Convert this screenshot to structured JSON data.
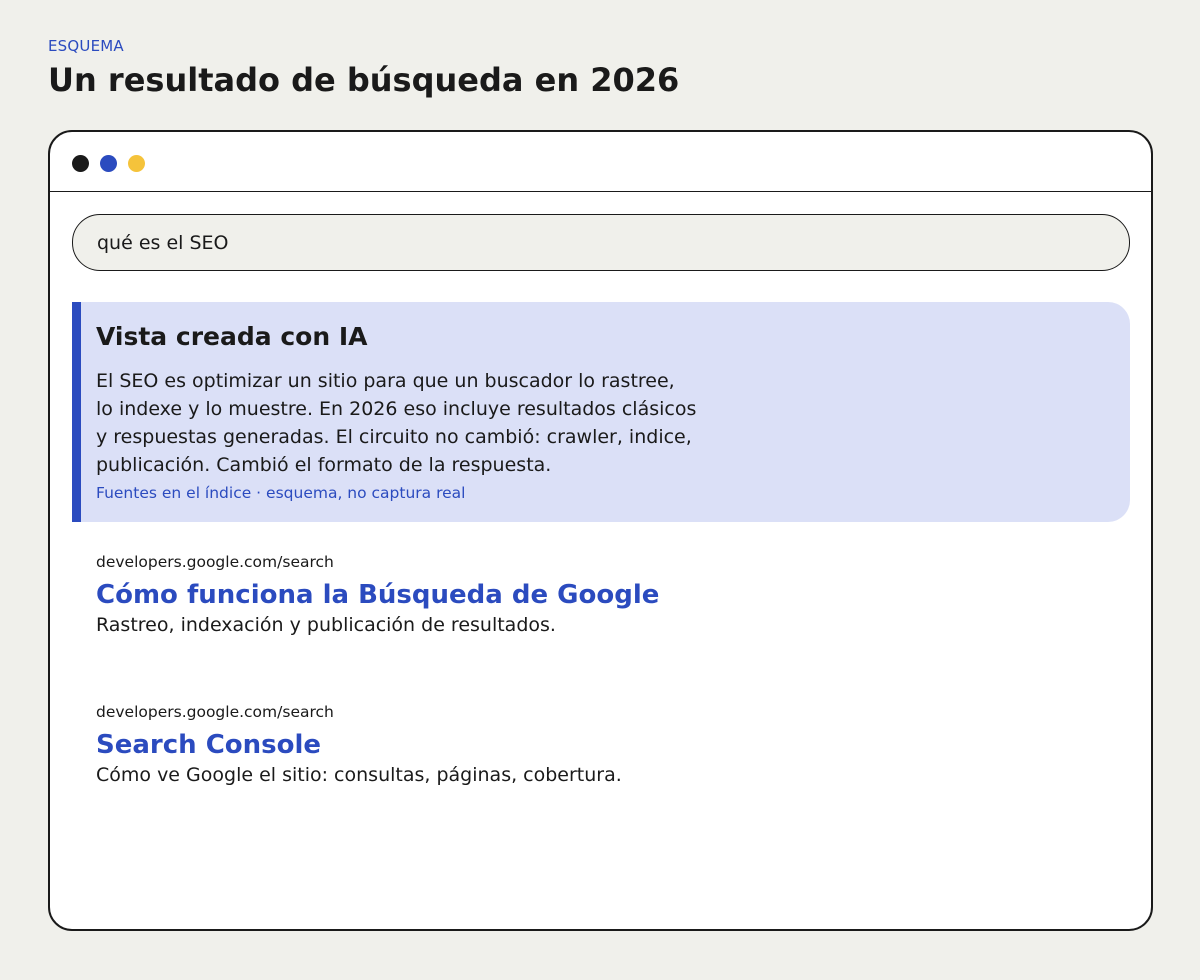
{
  "header": {
    "eyebrow": "ESQUEMA",
    "title": "Un resultado de búsqueda en 2026"
  },
  "window": {
    "dots": [
      "#1a1a1a",
      "#2b4bbf",
      "#f5c33b"
    ]
  },
  "search": {
    "query": "qué es el SEO"
  },
  "ai_overview": {
    "title": "Vista creada con IA",
    "lines": [
      "El SEO es optimizar un sitio para que un buscador lo rastree,",
      "lo indexe y lo muestre. En 2026 eso incluye resultados clásicos",
      "y respuestas generadas. El circuito no cambió: crawler, indice,",
      "publicación. Cambió el formato de la respuesta."
    ],
    "sources": "Fuentes en el índice · esquema, no captura real"
  },
  "results": [
    {
      "url": "developers.google.com/search",
      "title": "Cómo funciona la Búsqueda de Google",
      "snippet": "Rastreo, indexación y publicación de resultados."
    },
    {
      "url": "developers.google.com/search",
      "title": "Search Console",
      "snippet": "Cómo ve Google el sitio: consultas, páginas, cobertura."
    }
  ],
  "colors": {
    "accent": "#2b4bbf",
    "background": "#f0f0eb",
    "ai_panel": "#dbe0f7"
  }
}
